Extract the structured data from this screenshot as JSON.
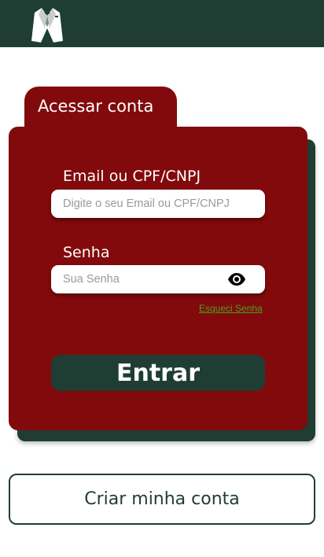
{
  "header": {
    "logo_icon": "suit-icon"
  },
  "login": {
    "tab_title": "Acessar conta",
    "email_label": "Email ou CPF/CNPJ",
    "email_placeholder": "Digite o seu Email ou CPF/CNPJ",
    "password_label": "Senha",
    "password_placeholder": "Sua Senha",
    "password_toggle_icon": "eye-icon",
    "forgot_link": "Esqueci Senha",
    "submit_label": "Entrar"
  },
  "signup": {
    "button_label": "Criar minha conta"
  },
  "colors": {
    "primary_dark_green": "#1f3d33",
    "card_red": "#820a0c",
    "link_green": "#4aa31f",
    "background": "#ffffff"
  }
}
